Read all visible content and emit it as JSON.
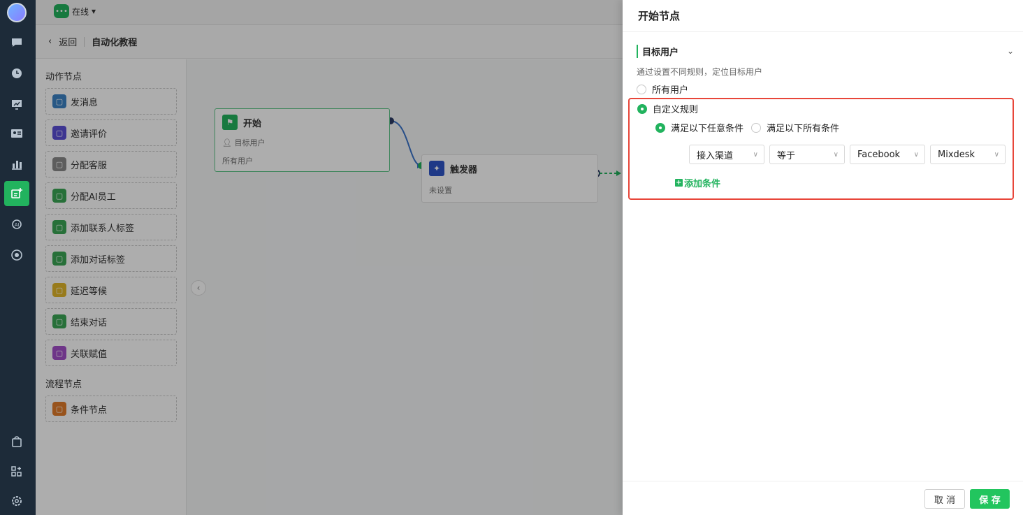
{
  "status": {
    "label": "在线"
  },
  "breadcrumb": {
    "back": "返回",
    "title": "自动化教程"
  },
  "palette": {
    "action_title": "动作节点",
    "actions": [
      {
        "label": "发消息",
        "icon": "message-icon",
        "color": "#3b82c4"
      },
      {
        "label": "邀请评价",
        "icon": "thumbs-up-icon",
        "color": "#5b4fd6"
      },
      {
        "label": "分配客服",
        "icon": "agent-icon",
        "color": "#8a8a8a"
      },
      {
        "label": "分配AI员工",
        "icon": "ai-agent-icon",
        "color": "#3aa655"
      },
      {
        "label": "添加联系人标签",
        "icon": "bookmark-icon",
        "color": "#3aa655"
      },
      {
        "label": "添加对话标签",
        "icon": "tag-icon",
        "color": "#3aa655"
      },
      {
        "label": "延迟等候",
        "icon": "clock-icon",
        "color": "#e0b52a"
      },
      {
        "label": "结束对话",
        "icon": "check-circle-icon",
        "color": "#3aa655"
      },
      {
        "label": "关联赋值",
        "icon": "link-arrow-icon",
        "color": "#a34fc9"
      }
    ],
    "flow_title": "流程节点",
    "flows": [
      {
        "label": "条件节点",
        "icon": "branch-icon",
        "color": "#e07b2a"
      }
    ]
  },
  "canvas": {
    "start_node": {
      "title": "开始",
      "row1": "目标用户",
      "row2": "所有用户"
    },
    "trigger_node": {
      "title": "触发器",
      "row1": "未设置"
    }
  },
  "drawer": {
    "title": "开始节点",
    "section": "目标用户",
    "description": "通过设置不同规则，定位目标用户",
    "option_all": "所有用户",
    "option_custom": "自定义规则",
    "match_any": "满足以下任意条件",
    "match_all": "满足以下所有条件",
    "condition": {
      "field": "接入渠道",
      "operator": "等于",
      "channel": "Facebook",
      "value": "Mixdesk"
    },
    "add_condition": "添加条件",
    "cancel": "取 消",
    "save": "保 存"
  }
}
